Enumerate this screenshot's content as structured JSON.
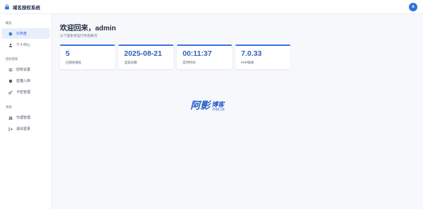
{
  "app": {
    "title": "域名授权系统"
  },
  "user": {
    "avatar_letter": "A"
  },
  "sidebar": {
    "sections": [
      {
        "title": "概览",
        "items": [
          {
            "label": "仪表盘",
            "icon": "dashboard-icon",
            "active": true
          },
          {
            "label": "个人中心",
            "icon": "user-icon"
          }
        ]
      },
      {
        "title": "授权管理",
        "items": [
          {
            "label": "授权设置",
            "icon": "list-icon"
          },
          {
            "label": "蓝猫入库",
            "icon": "shield-icon"
          },
          {
            "label": "卡密管理",
            "icon": "key-icon"
          }
        ]
      },
      {
        "title": "系统",
        "items": [
          {
            "label": "代理管理",
            "icon": "users-icon"
          },
          {
            "label": "退出登录",
            "icon": "logout-icon"
          }
        ]
      }
    ]
  },
  "main": {
    "welcome": "欢迎回来，admin",
    "subtitle": "以下是系统运行状态概况",
    "cards": [
      {
        "value": "5",
        "label": "已授权域名"
      },
      {
        "value": "2025-08-21",
        "label": "当前日期"
      },
      {
        "value": "00:11:37",
        "label": "实时时间"
      },
      {
        "value": "7.0.33",
        "label": "PHP版本"
      }
    ]
  },
  "watermark": {
    "text": "阿影博客",
    "subtext": "AYBK.CN"
  },
  "colors": {
    "accent": "#2f6fdb",
    "card_value": "#2f5fb8",
    "watermark": "#2a62c9"
  }
}
